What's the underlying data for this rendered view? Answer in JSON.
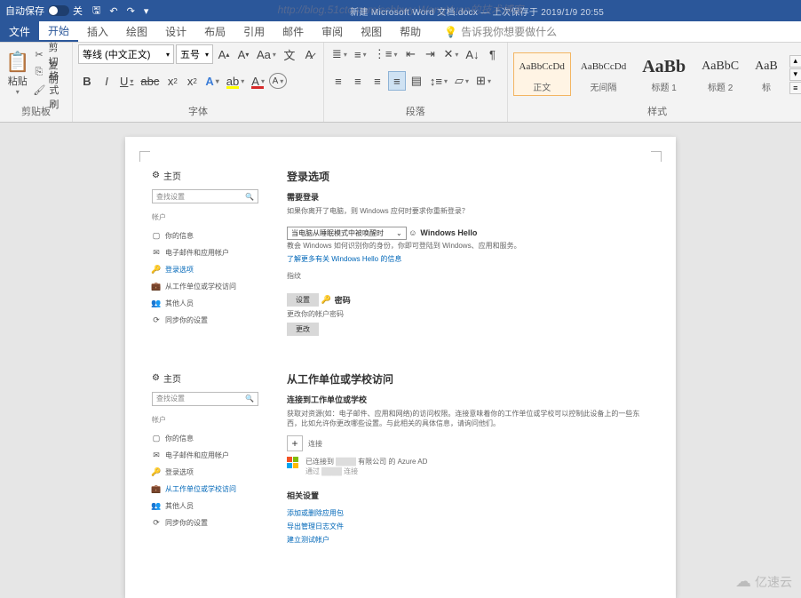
{
  "titlebar": {
    "autosave_label": "自动保存",
    "autosave_state": "关",
    "doc_title": "新建 Microsoft Word 文档.docx — 上次保存于 2019/1/9 20:55"
  },
  "watermark": {
    "top": "http://blog.51cto.com/schbwy WangYuan的技术博客",
    "bottom": "亿速云"
  },
  "menu": {
    "file": "文件",
    "start": "开始",
    "insert": "插入",
    "draw": "绘图",
    "design": "设计",
    "layout": "布局",
    "references": "引用",
    "mailings": "邮件",
    "review": "审阅",
    "view": "视图",
    "help": "帮助",
    "tell_me": "告诉我你想要做什么"
  },
  "ribbon": {
    "clipboard": {
      "paste": "粘贴",
      "cut": "剪切",
      "copy": "复制",
      "format_painter": "格式刷",
      "label": "剪贴板"
    },
    "font": {
      "name": "等线 (中文正文)",
      "size": "五号",
      "label": "字体"
    },
    "paragraph": {
      "label": "段落"
    },
    "styles": {
      "s1": {
        "preview": "AaBbCcDd",
        "name": "正文"
      },
      "s2": {
        "preview": "AaBbCcDd",
        "name": "无间隔"
      },
      "s3": {
        "preview": "AaBb",
        "name": "标题 1"
      },
      "s4": {
        "preview": "AaBbC",
        "name": "标题 2"
      },
      "s5": {
        "preview": "AaB",
        "name": "标"
      },
      "label": "样式"
    }
  },
  "doc": {
    "panel1": {
      "home": "主页",
      "search_ph": "查找设置",
      "section": "帐户",
      "nav": {
        "info": "你的信息",
        "email": "电子邮件和应用帐户",
        "signin": "登录选项",
        "work": "从工作单位或学校访问",
        "others": "其他人员",
        "sync": "同步你的设置"
      },
      "right": {
        "title": "登录选项",
        "need_login": "需要登录",
        "need_login_body": "如果你离开了电脑，则 Windows 应何时要求你重新登录？",
        "select_val": "当电脑从睡眠模式中被唤醒时",
        "hello": "Windows Hello",
        "hello_body": "教会 Windows 如何识别你的身份，你即可登陆到 Windows、应用和服务。",
        "hello_link": "了解更多有关 Windows Hello 的信息",
        "finger": "指纹",
        "setup": "设置",
        "password": "密码",
        "password_body": "更改你的帐户密码",
        "change": "更改"
      }
    },
    "panel2": {
      "home": "主页",
      "search_ph": "查找设置",
      "section": "帐户",
      "nav": {
        "info": "你的信息",
        "email": "电子邮件和应用帐户",
        "signin": "登录选项",
        "work": "从工作单位或学校访问",
        "others": "其他人员",
        "sync": "同步你的设置"
      },
      "right": {
        "title": "从工作单位或学校访问",
        "connect_h": "连接到工作单位或学校",
        "connect_body": "获取对资源(如：电子邮件、应用和网络)的访问权限。连接意味着你的工作单位或学校可以控制此设备上的一些东西，比如允许你更改哪些设置。与此相关的具体信息，请询问他们。",
        "connect_btn": "连接",
        "connected": "已连接到",
        "azure": "有限公司 的 Azure AD",
        "via": "通过",
        "related_h": "相关设置",
        "link1": "添加或删除应用包",
        "link2": "导出管理日志文件",
        "link3": "建立测试帐户"
      }
    }
  }
}
